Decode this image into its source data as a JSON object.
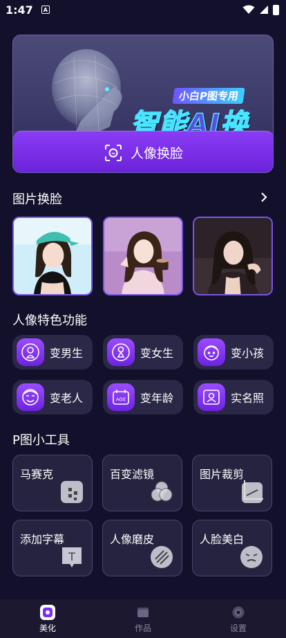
{
  "status_bar": {
    "time": "1:47",
    "notification_glyph": "A"
  },
  "banner": {
    "subtitle": "小白P图专用",
    "title": "智能AI换脸",
    "button_label": "人像换脸"
  },
  "photo_swap": {
    "title": "图片换脸",
    "cards": [
      {
        "name": "photo-1",
        "hair": "#2b2016",
        "top": "#111111",
        "bg": "#cfeefa"
      },
      {
        "name": "photo-2",
        "hair": "#3a2418",
        "top": "#f2d6df",
        "bg": "#b98cc9"
      },
      {
        "name": "photo-3",
        "hair": "#1c1512",
        "top": "#2a1f22",
        "bg": "#3b2e35"
      }
    ]
  },
  "portrait_features": {
    "title": "人像特色功能",
    "items": [
      {
        "label": "变男生",
        "icon": "male-icon"
      },
      {
        "label": "变女生",
        "icon": "female-icon"
      },
      {
        "label": "变小孩",
        "icon": "child-icon"
      },
      {
        "label": "变老人",
        "icon": "elder-icon"
      },
      {
        "label": "变年龄",
        "icon": "age-icon"
      },
      {
        "label": "实名照",
        "icon": "id-photo-icon"
      }
    ],
    "age_icon_text": "AGE"
  },
  "tools": {
    "title": "P图小工具",
    "items": [
      {
        "label": "马赛克",
        "icon": "mosaic-icon"
      },
      {
        "label": "百变滤镜",
        "icon": "filter-icon"
      },
      {
        "label": "图片裁剪",
        "icon": "crop-icon"
      },
      {
        "label": "添加字幕",
        "icon": "text-icon"
      },
      {
        "label": "人像磨皮",
        "icon": "smooth-icon"
      },
      {
        "label": "人脸美白",
        "icon": "whiten-icon"
      }
    ],
    "text_icon_glyph": "T"
  },
  "bottom_nav": {
    "items": [
      {
        "label": "美化",
        "active": true
      },
      {
        "label": "作品",
        "active": false
      },
      {
        "label": "设置",
        "active": false
      }
    ]
  },
  "colors": {
    "accent": "#7b2ff0",
    "background": "#12102a",
    "card": "#262340"
  }
}
